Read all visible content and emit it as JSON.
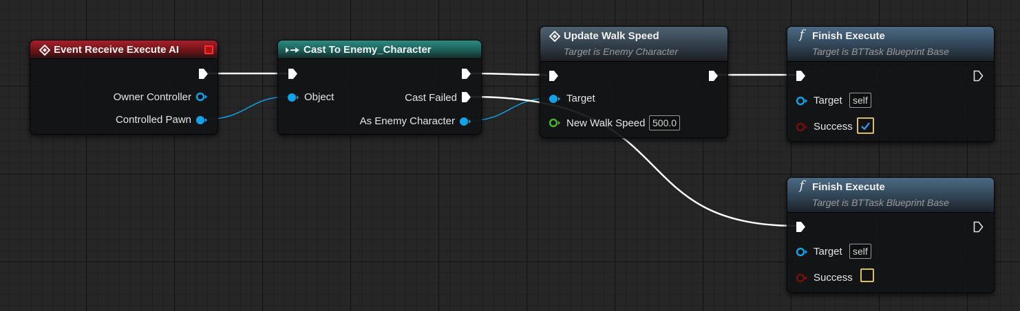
{
  "colors": {
    "canvas_bg": "#262626",
    "event_header": "#8e1a1a",
    "cast_header": "#1f6a63",
    "function_header": "#3e4f60",
    "exec_wire": "#ffffff",
    "object_pin": "#0fa3e8",
    "float_pin": "#46b72a",
    "bool_pin": "#7a0d0d",
    "checkbox_border": "#d8c45a"
  },
  "nodes": {
    "event": {
      "title": "Event Receive Execute AI",
      "icon": "event-diamond-icon",
      "pins": {
        "owner_controller": "Owner Controller",
        "controlled_pawn": "Controlled Pawn"
      }
    },
    "cast": {
      "title": "Cast To Enemy_Character",
      "icon": "cast-arrows-icon",
      "pins": {
        "object": "Object",
        "cast_failed": "Cast Failed",
        "as_enemy_character": "As Enemy Character"
      }
    },
    "update": {
      "title": "Update Walk Speed",
      "subtitle": "Target is Enemy Character",
      "icon": "event-diamond-icon",
      "pins": {
        "target": "Target",
        "new_walk_speed": "New Walk Speed"
      },
      "new_walk_speed_value": "500.0"
    },
    "finish1": {
      "title": "Finish Execute",
      "subtitle": "Target is BTTask Blueprint Base",
      "icon": "function-f-icon",
      "icon_glyph": "f",
      "pins": {
        "target": "Target",
        "success": "Success"
      },
      "target_value": "self",
      "success_checked": true
    },
    "finish2": {
      "title": "Finish Execute",
      "subtitle": "Target is BTTask Blueprint Base",
      "icon": "function-f-icon",
      "icon_glyph": "f",
      "pins": {
        "target": "Target",
        "success": "Success"
      },
      "target_value": "self",
      "success_checked": false
    }
  }
}
